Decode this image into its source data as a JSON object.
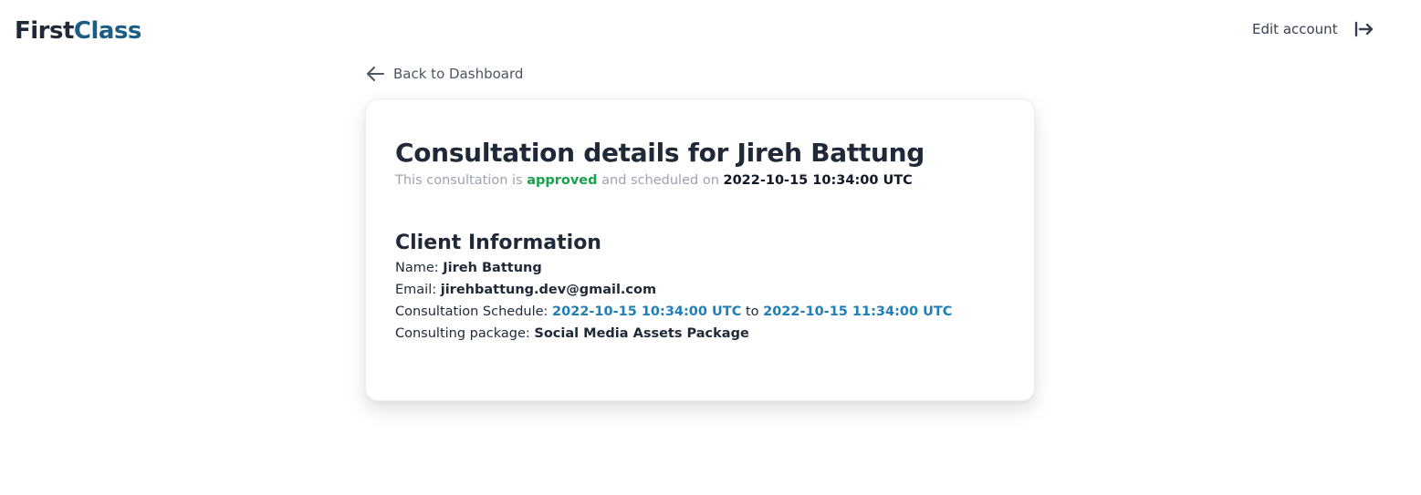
{
  "header": {
    "logo_first": "First",
    "logo_class": "Class",
    "edit_account_label": "Edit account",
    "logout_icon": "logout-arrow-icon"
  },
  "nav": {
    "back_label": "Back to Dashboard",
    "back_icon": "arrow-left-icon"
  },
  "consultation": {
    "title": "Consultation details for Jireh Battung",
    "subtitle_prefix": "This consultation is ",
    "status": "approved",
    "subtitle_middle": " and scheduled on ",
    "scheduled_on": "2022-10-15 10:34:00 UTC"
  },
  "client": {
    "section_title": "Client Information",
    "name_label": "Name:",
    "name_value": "Jireh Battung",
    "email_label": "Email:",
    "email_value": "jirehbattung.dev@gmail.com",
    "schedule_label": "Consultation Schedule:",
    "schedule_start": "2022-10-15 10:34:00 UTC",
    "schedule_to": "to",
    "schedule_end": "2022-10-15 11:34:00 UTC",
    "package_label": "Consulting package:",
    "package_value": "Social Media Assets Package"
  },
  "colors": {
    "brand_dark": "#1f2937",
    "brand_accent": "#1b5d85",
    "approved": "#16a34a",
    "link_blue": "#1f7fb8"
  }
}
